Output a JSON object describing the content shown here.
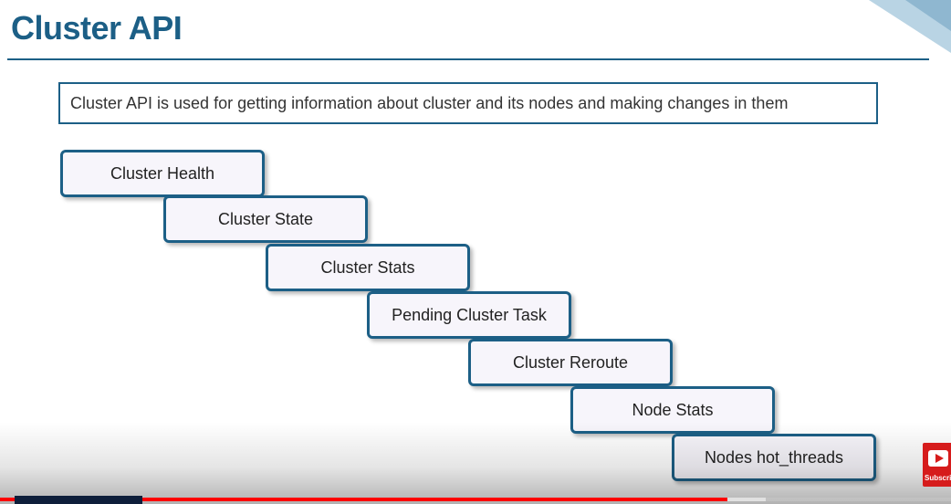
{
  "slide": {
    "title": "Cluster API",
    "description": "Cluster API is used for getting information about cluster and its nodes and making changes in them"
  },
  "steps": [
    "Cluster Health",
    "Cluster State",
    "Cluster Stats",
    "Pending Cluster Task",
    "Cluster Reroute",
    "Node Stats",
    "Nodes hot_threads"
  ],
  "player": {
    "played_fraction": 0.765,
    "buffered_fraction": 0.805
  },
  "watermark": {
    "label": "Subscribe",
    "icon": "play-button-icon"
  },
  "colors": {
    "accent": "#1c5f86",
    "box_fill": "#f7f5fb",
    "progress": "#ff0000",
    "watermark": "#d61c1c"
  }
}
